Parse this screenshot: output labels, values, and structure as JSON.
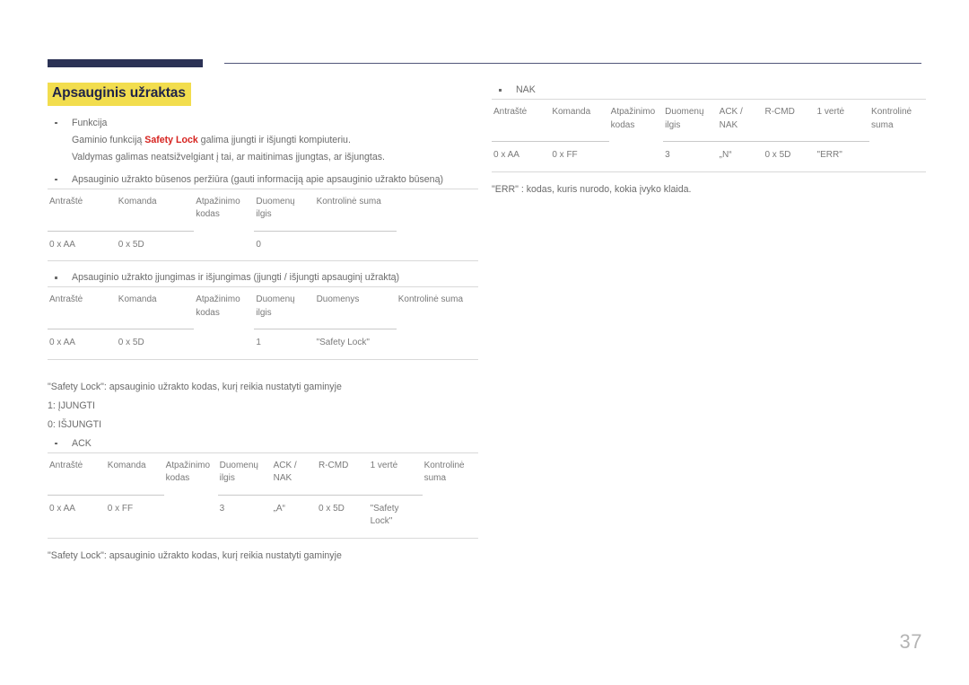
{
  "document": {
    "page_number": "37",
    "heading": "Apsauginis užraktas",
    "accent_heading_bg": "#f2dd4e",
    "accent_heading_text": "#1f2348",
    "accent_red": "#d6231f",
    "header_bar_color": "#2b3255",
    "rule_color": "#c9c9c9"
  },
  "left_column": {
    "function_bullet": {
      "label": "Funkcija",
      "line1_before": "Gaminio funkciją ",
      "line1_highlight": "Safety Lock",
      "line1_after": " galima įjungti ir išjungti kompiuteriu.",
      "line2": "Valdymas galimas neatsižvelgiant į tai, ar maitinimas įjungtas, ar išjungtas."
    },
    "status_check": {
      "bullet": "Apsauginio užrakto būsenos peržiūra (gauti informaciją apie apsauginio užrakto būseną)",
      "headers": [
        "Antraštė",
        "Komanda",
        "Atpažinimo kodas",
        "Duomenų ilgis",
        "Kontrolinė suma"
      ],
      "row": [
        "0 x AA",
        "0 x 5D",
        "",
        "0",
        ""
      ]
    },
    "toggle": {
      "bullet": "Apsauginio užrakto įjungimas ir išjungimas (įjungti / išjungti apsauginį užraktą)",
      "headers": [
        "Antraštė",
        "Komanda",
        "Atpažinimo kodas",
        "Duomenų ilgis",
        "Duomenys",
        "Kontrolinė suma"
      ],
      "row": [
        "0 x AA",
        "0 x 5D",
        "",
        "1",
        "\"Safety Lock\"",
        ""
      ]
    },
    "notes": [
      "\"Safety Lock\": apsauginio užrakto kodas, kurį reikia nustatyti gaminyje",
      "1: ĮJUNGTI",
      "0: IŠJUNGTI"
    ],
    "ack": {
      "bullet": "ACK",
      "headers": [
        "Antraštė",
        "Komanda",
        "Atpažinimo kodas",
        "Duomenų ilgis",
        "ACK / NAK",
        "R-CMD",
        "1 vertė",
        "Kontrolinė suma"
      ],
      "row": [
        "0 x AA",
        "0 x FF",
        "",
        "3",
        "„A“",
        "0 x 5D",
        "\"Safety Lock\"",
        ""
      ]
    },
    "footer_note": "\"Safety Lock\": apsauginio užrakto kodas, kurį reikia nustatyti gaminyje"
  },
  "right_column": {
    "nak": {
      "bullet": "NAK",
      "headers": [
        "Antraštė",
        "Komanda",
        "Atpažinimo kodas",
        "Duomenų ilgis",
        "ACK / NAK",
        "R-CMD",
        "1 vertė",
        "Kontrolinė suma"
      ],
      "row": [
        "0 x AA",
        "0 x FF",
        "",
        "3",
        "„N“",
        "0 x 5D",
        "\"ERR\"",
        ""
      ]
    },
    "footer_note": "\"ERR\" : kodas, kuris nurodo, kokia įvyko klaida."
  }
}
